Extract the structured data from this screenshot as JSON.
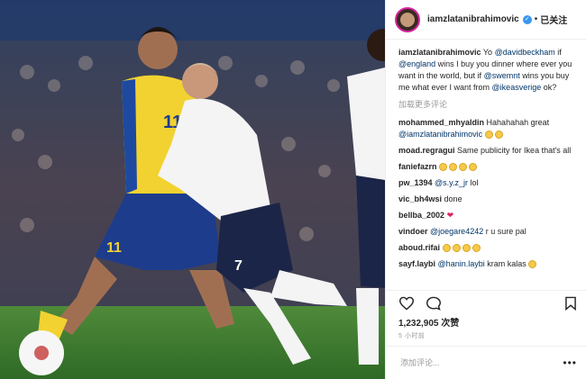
{
  "post": {
    "username": "iamzlatanibrahimovic",
    "separator": "•",
    "follow_label": "已关注",
    "caption": {
      "username": "iamzlatanibrahimovic",
      "parts": [
        "Yo ",
        "@davidbeckham",
        " if ",
        "@england",
        " wins I buy you dinner where ever you want in the world, but if ",
        "@swemnt",
        " wins you buy me what ever I want from ",
        "@ikeasverige",
        " ok?"
      ]
    },
    "show_more": "加载更多评论",
    "comments": [
      {
        "user": "mohammed_mhyaldin",
        "text": "Hahahahah great",
        "mention": "@iamzlatanibrahimovic",
        "emojis": 2
      },
      {
        "user": "moad.regragui",
        "text": "Same publicity for Ikea that's all"
      },
      {
        "user": "faniefazrn",
        "text": "",
        "emojis": 4
      },
      {
        "user": "pw_1394",
        "mention": "@s.y.z_jr",
        "text": "lol"
      },
      {
        "user": "vic_bh4wsi",
        "text": "done"
      },
      {
        "user": "bellba_2002",
        "text": "",
        "heart": "❤"
      },
      {
        "user": "vindoer",
        "mention": "@joegare4242",
        "text": "r u sure pal"
      },
      {
        "user": "aboud.rifai",
        "text": "",
        "emojis": 4
      },
      {
        "user": "sayf.laybi",
        "mention": "@hanin.laybi",
        "text": "kram kalas",
        "emojis": 1
      }
    ],
    "likes": "1,232,905 次赞",
    "time": "5 小时前",
    "add_comment_placeholder": "添加评论...",
    "options_icon": "•••"
  },
  "photo": {
    "description_icon": "football-match-photo",
    "shirt_number_yellow": "11",
    "shirt_number_white": "7"
  },
  "icons": {
    "like": "heart-icon",
    "comment": "comment-icon",
    "bookmark": "bookmark-icon"
  },
  "colors": {
    "link": "#003569",
    "verified": "#3897f0",
    "text": "#262626",
    "muted": "#999999"
  }
}
